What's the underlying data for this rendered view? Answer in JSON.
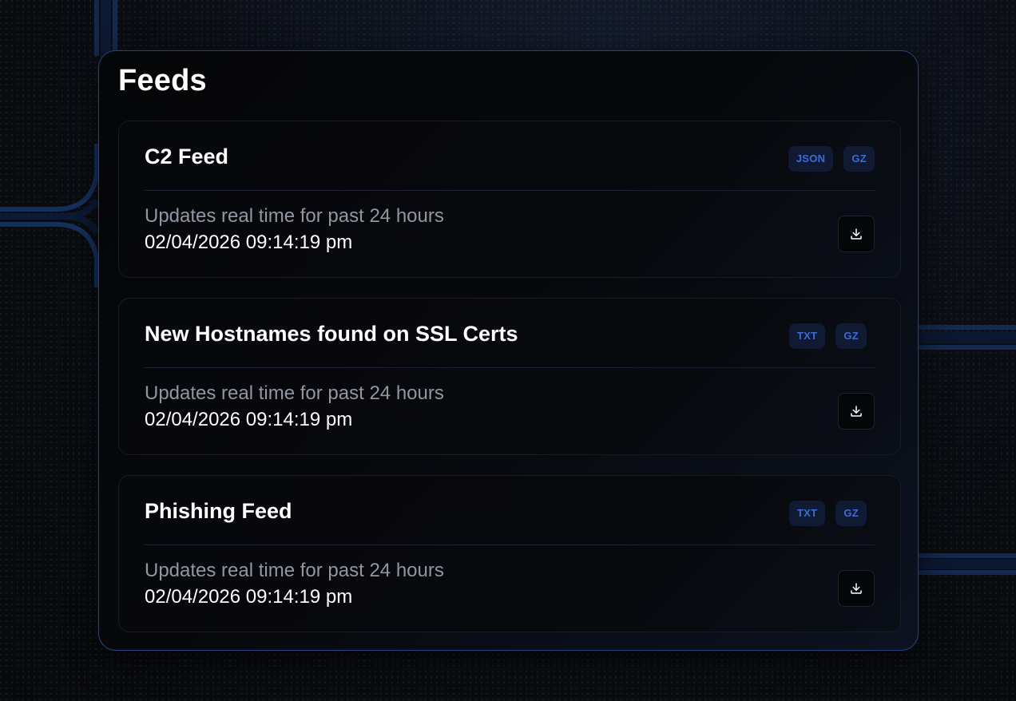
{
  "page": {
    "title": "Feeds"
  },
  "colors": {
    "accent": "#3d6bd8",
    "tag_bg": "#101b33",
    "panel_border": "#26417a",
    "subtitle": "#9097a3"
  },
  "feeds": [
    {
      "title": "C2 Feed",
      "tags": [
        "JSON",
        "GZ"
      ],
      "subtitle": "Updates real time for past 24 hours",
      "timestamp": "02/04/2026 09:14:19 pm",
      "action_icon": "download-icon"
    },
    {
      "title": "New Hostnames found on SSL Certs",
      "tags": [
        "TXT",
        "GZ"
      ],
      "subtitle": "Updates real time for past 24 hours",
      "timestamp": "02/04/2026 09:14:19 pm",
      "action_icon": "download-icon"
    },
    {
      "title": "Phishing Feed",
      "tags": [
        "TXT",
        "GZ"
      ],
      "subtitle": "Updates real time for past 24 hours",
      "timestamp": "02/04/2026 09:14:19 pm",
      "action_icon": "download-icon"
    }
  ]
}
